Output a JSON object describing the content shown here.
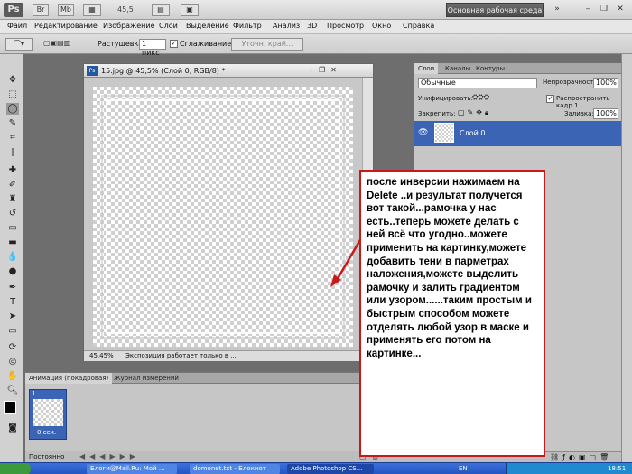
{
  "appbar": {
    "logo": "Ps",
    "btn_br": "Br",
    "btn_mb": "Mb",
    "zoom": "45,5",
    "workspace": "Основная рабочая среда",
    "minimize": "–",
    "restore": "❐",
    "close": "✕"
  },
  "menu": [
    "Файл",
    "Редактирование",
    "Изображение",
    "Слои",
    "Выделение",
    "Фильтр",
    "Анализ",
    "3D",
    "Просмотр",
    "Окно",
    "Справка"
  ],
  "options": {
    "feather_label": "Растушевка:",
    "feather_value": "1 пикс",
    "antialias_label": "Сглаживание",
    "refine_button": "Уточн. край..."
  },
  "document": {
    "title": "15.jpg @ 45,5% (Слой 0, RGB/8) *",
    "zoom": "45,45%",
    "status": "Экспозиция работает только в ..."
  },
  "panels": {
    "tabs": [
      "Слои",
      "Каналы",
      "Контуры"
    ],
    "blend_mode": "Обычные",
    "opacity_label": "Непрозрачность:",
    "opacity_value": "100%",
    "unify_label": "Унифицировать:",
    "propagate_label": "Распространить кадр 1",
    "lock_label": "Закрепить:",
    "fill_label": "Заливка:",
    "fill_value": "100%",
    "layer_name": "Слой 0"
  },
  "animation": {
    "tabs": [
      "Анимация (покадровая)",
      "Журнал измерений"
    ],
    "frame_number": "1",
    "frame_delay": "0 сек.",
    "loop": "Постоянно"
  },
  "annotation": {
    "text": "после инверсии нажимаем на Delete ..и результат получется вот такой...рамочка у нас есть..теперь можете делать с ней всё что угодно..можете применить на картинку,можете  добавить тени в парметрах наложения,можете выделить рамочку и  залить градиентом или узором......таким простым и быстрым способом можете отделять любой узор в маске и применять его потом на картинке..."
  },
  "taskbar": {
    "items": [
      "Блоги@Mail.Ru: Мой ...",
      "domonet.txt - Блокнот",
      "Adobe Photoshop CS..."
    ],
    "lang": "EN",
    "clock": "18:51"
  },
  "colors": {
    "accent_layer": "#3c64b5",
    "note_border": "#c91818",
    "workspace_bg": "#6e6e6e"
  }
}
